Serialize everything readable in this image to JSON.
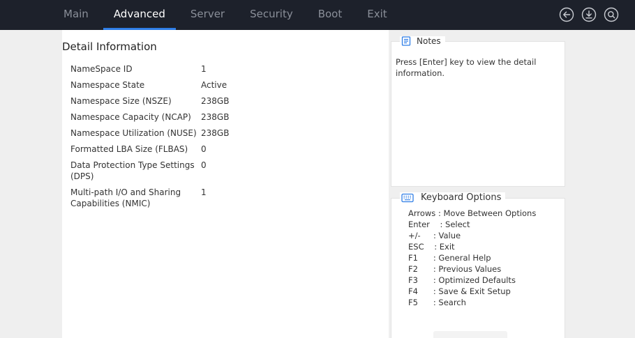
{
  "topbar": {
    "tabs": [
      {
        "label": "Main"
      },
      {
        "label": "Advanced"
      },
      {
        "label": "Server"
      },
      {
        "label": "Security"
      },
      {
        "label": "Boot"
      },
      {
        "label": "Exit"
      }
    ],
    "active_tab": "Advanced",
    "icons": [
      "back-arrow-icon",
      "save-download-icon",
      "search-icon"
    ],
    "accent_color": "#2f7ee6",
    "bar_color": "#1d212b"
  },
  "main": {
    "title": "Detail Information",
    "rows": [
      {
        "label": "NameSpace ID",
        "value": "1"
      },
      {
        "label": "Namespace State",
        "value": "Active"
      },
      {
        "label": "Namespace Size (NSZE)",
        "value": "238GB"
      },
      {
        "label": "Namespace Capacity (NCAP)",
        "value": "238GB"
      },
      {
        "label": "Namespace Utilization (NUSE)",
        "value": "238GB"
      },
      {
        "label": "Formatted LBA Size (FLBAS)",
        "value": "0"
      },
      {
        "label": "Data Protection Type Settings (DPS)",
        "value": "0"
      },
      {
        "label": "Multi-path I/O and Sharing Capabilities (NMIC)",
        "value": "1"
      }
    ]
  },
  "notes": {
    "title": "Notes",
    "text": "Press [Enter] key to view the detail information."
  },
  "keyboard": {
    "title": "Keyboard Options",
    "items": [
      {
        "key": "Arrows",
        "desc": " : Move Between Options"
      },
      {
        "key": "Enter",
        "desc": "    : Select"
      },
      {
        "key": "+/-",
        "desc": "     : Value"
      },
      {
        "key": "ESC",
        "desc": "    : Exit"
      },
      {
        "key": "F1",
        "desc": "      : General Help"
      },
      {
        "key": "F2",
        "desc": "      : Previous Values"
      },
      {
        "key": "F3",
        "desc": "      : Optimized Defaults"
      },
      {
        "key": "F4",
        "desc": "      : Save & Exit Setup"
      },
      {
        "key": "F5",
        "desc": "      : Search"
      }
    ]
  }
}
